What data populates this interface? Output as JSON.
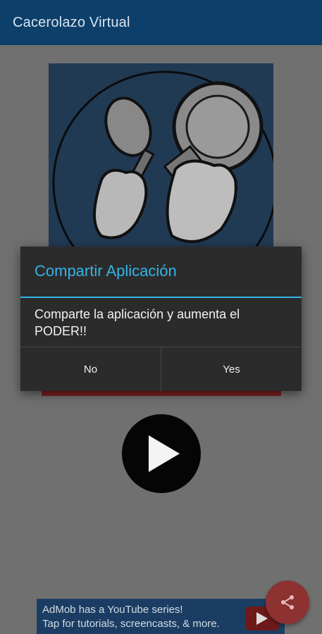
{
  "appbar": {
    "title": "Cacerolazo Virtual"
  },
  "dialog": {
    "title": "Compartir Aplicación",
    "message": "Comparte la aplicación y aumenta el PODER!!",
    "buttons": {
      "no": "No",
      "yes": "Yes"
    }
  },
  "ad": {
    "line1": "AdMob has a YouTube series!",
    "line2": "Tap for tutorials, screencasts, & more."
  },
  "colors": {
    "appbar": "#0d3f6b",
    "dialog_accent": "#33b5e5",
    "fab": "#8e3131"
  },
  "icons": [
    "play-icon",
    "share-icon",
    "youtube-play-icon"
  ]
}
